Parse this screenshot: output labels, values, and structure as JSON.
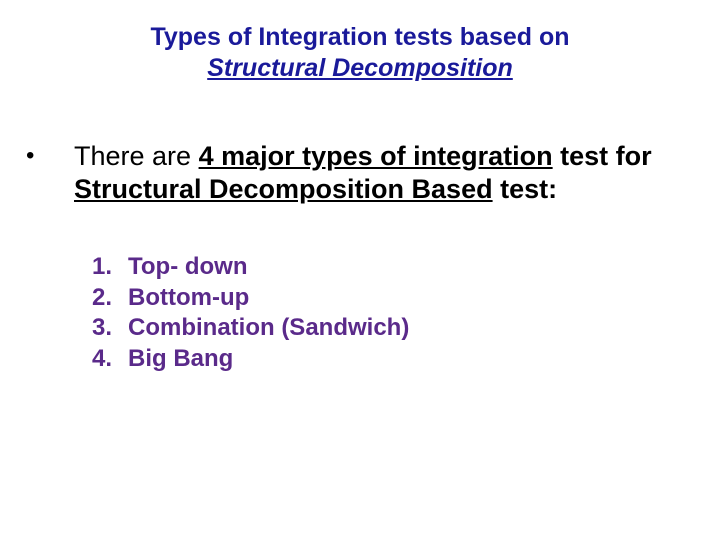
{
  "title": {
    "line1": "Types of Integration tests based on",
    "line2": "Structural Decomposition"
  },
  "bullet": {
    "marker": "•",
    "pre": "There are ",
    "underlined1": "4 major types of integration",
    "post1": " test for ",
    "underlined2": "Structural Decomposition Based",
    "post2": " test:"
  },
  "list": [
    {
      "num": "1.",
      "text": "Top- down"
    },
    {
      "num": "2.",
      "text": "Bottom-up"
    },
    {
      "num": "3.",
      "text": "Combination (Sandwich)"
    },
    {
      "num": "4.",
      "text": "Big Bang"
    }
  ]
}
